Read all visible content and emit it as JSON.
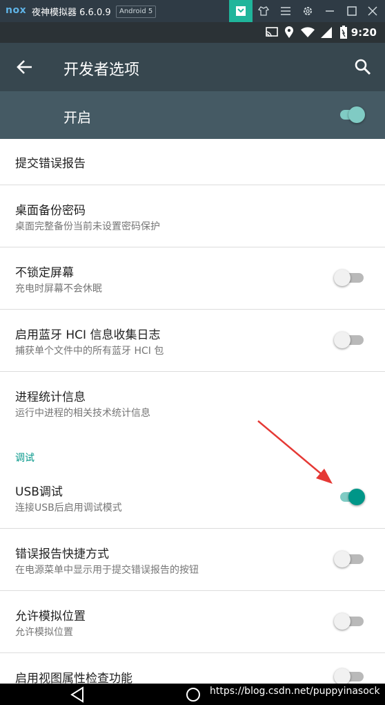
{
  "emulator": {
    "logo": "nox",
    "title": "夜神模拟器 6.6.0.9",
    "badge": "Android 5"
  },
  "status": {
    "time": "9:20"
  },
  "toolbar": {
    "title": "开发者选项"
  },
  "master": {
    "label": "开启",
    "on": true
  },
  "settings": [
    {
      "title": "提交错误报告"
    },
    {
      "title": "桌面备份密码",
      "summary": "桌面完整备份当前未设置密码保护"
    },
    {
      "title": "不锁定屏幕",
      "summary": "充电时屏幕不会休眠",
      "on": false
    },
    {
      "title": "启用蓝牙 HCI 信息收集日志",
      "summary": "捕获单个文件中的所有蓝牙 HCI 包",
      "on": false
    },
    {
      "title": "进程统计信息",
      "summary": "运行中进程的相关技术统计信息"
    },
    {
      "category": "调试"
    },
    {
      "title": "USB调试",
      "summary": "连接USB后启用调试模式",
      "on": true
    },
    {
      "title": "错误报告快捷方式",
      "summary": "在电源菜单中显示用于提交错误报告的按钮",
      "on": false
    },
    {
      "title": "允许模拟位置",
      "summary": "允许模拟位置",
      "on": false
    },
    {
      "title": "启用视图属性检查功能",
      "on": false
    }
  ],
  "watermark": "https://blog.csdn.net/puppyinasock",
  "colors": {
    "accent": "#009688",
    "toolbar": "#37474f",
    "master_bar": "#455a64",
    "arrow": "#e53935"
  },
  "icons": [
    "nox-logo",
    "gift-icon",
    "shirt-icon",
    "menu-icon",
    "gear-icon",
    "minimize-icon",
    "maximize-icon",
    "close-icon",
    "cast-icon",
    "location-icon",
    "wifi-icon",
    "signal-icon",
    "battery-icon",
    "back-arrow-icon",
    "search-icon",
    "nav-back-icon",
    "nav-home-icon"
  ]
}
